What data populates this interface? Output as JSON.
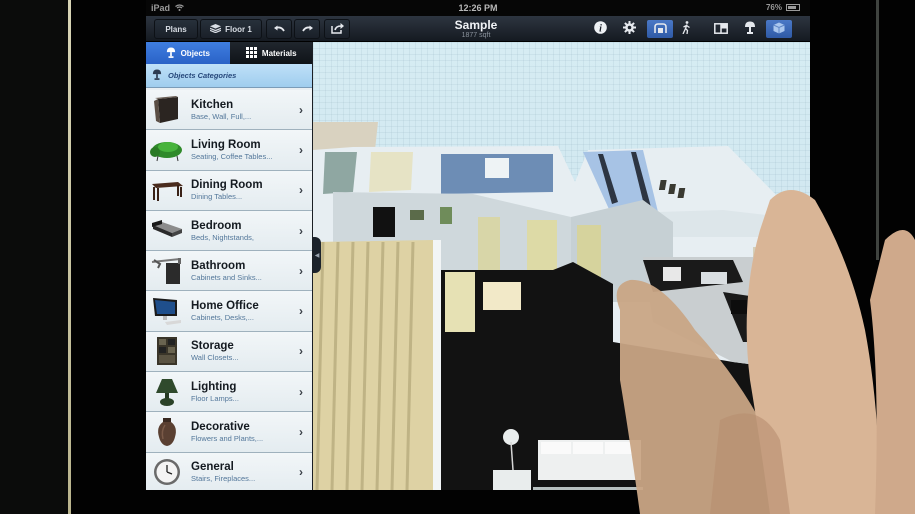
{
  "status_bar": {
    "device": "iPad",
    "wifi_icon": "wifi-icon",
    "time": "12:26 PM",
    "battery_text": "76%",
    "battery_level": 0.76
  },
  "toolbar": {
    "plans_label": "Plans",
    "floor_label": "Floor 1",
    "floor_icon": "layers-icon",
    "undo_icon": "undo-icon",
    "redo_icon": "redo-icon",
    "share_icon": "share-icon",
    "project_title": "Sample",
    "project_area": "1877 sqft",
    "right_icons": [
      {
        "name": "info-icon",
        "glyph": "i",
        "active": false
      },
      {
        "name": "gear-icon",
        "glyph": "⚙",
        "active": false
      },
      {
        "name": "3d-view-icon",
        "glyph": "⌂",
        "active": true
      },
      {
        "name": "walk-icon",
        "glyph": "🚶",
        "active": false
      },
      {
        "name": "split-view-icon",
        "glyph": "◫",
        "active": false
      },
      {
        "name": "lamp-icon",
        "glyph": "☂",
        "active": false
      },
      {
        "name": "cube-icon",
        "glyph": "◉",
        "active": true
      }
    ]
  },
  "sidebar": {
    "tabs": [
      {
        "label": "Objects",
        "icon": "lamp-icon",
        "active": true
      },
      {
        "label": "Materials",
        "icon": "grid-icon",
        "active": false
      }
    ],
    "section_title": "Objects Categories",
    "categories": [
      {
        "label": "Kitchen",
        "desc": "Base, Wall, Full,...",
        "icon": "kitchen-cabinet-icon"
      },
      {
        "label": "Living Room",
        "desc": "Seating, Coffee Tables...",
        "icon": "sofa-icon"
      },
      {
        "label": "Dining Room",
        "desc": "Dining Tables...",
        "icon": "dining-table-icon"
      },
      {
        "label": "Bedroom",
        "desc": "Beds, Nightstands,",
        "icon": "bed-icon"
      },
      {
        "label": "Bathroom",
        "desc": "Cabinets and Sinks...",
        "icon": "bathroom-sink-icon"
      },
      {
        "label": "Home Office",
        "desc": "Cabinets, Desks,...",
        "icon": "computer-icon"
      },
      {
        "label": "Storage",
        "desc": "Wall Closets...",
        "icon": "closet-icon"
      },
      {
        "label": "Lighting",
        "desc": "Floor Lamps...",
        "icon": "lamp-icon"
      },
      {
        "label": "Decorative",
        "desc": "Flowers and Plants,...",
        "icon": "vase-icon"
      },
      {
        "label": "General",
        "desc": "Stairs, Fireplaces...",
        "icon": "clock-icon"
      }
    ]
  },
  "colors": {
    "accent": "#3b78dc",
    "toolbar": "#1c232c",
    "sky": "#d3eaf2"
  }
}
